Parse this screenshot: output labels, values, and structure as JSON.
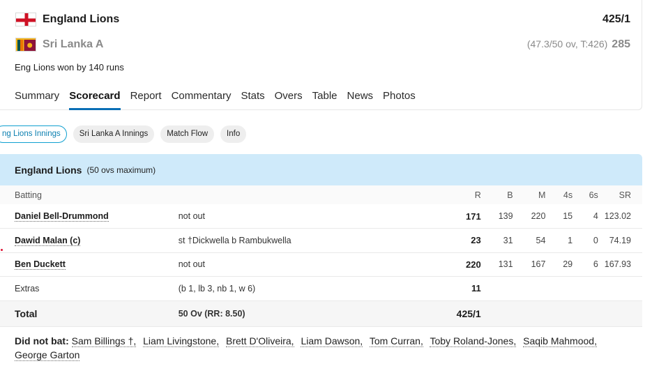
{
  "teams": [
    {
      "name": "England Lions",
      "score": "425/1",
      "overs_info": "",
      "flag": "england-flag"
    },
    {
      "name": "Sri Lanka A",
      "score": "285",
      "overs_info": "(47.3/50 ov, T:426)",
      "flag": "sri-lanka-flag"
    }
  ],
  "result": "Eng Lions won by 140 runs",
  "tabs": [
    "Summary",
    "Scorecard",
    "Report",
    "Commentary",
    "Stats",
    "Overs",
    "Table",
    "News",
    "Photos"
  ],
  "active_tab": "Scorecard",
  "pills": [
    "ng Lions Innings",
    "Sri Lanka A Innings",
    "Match Flow",
    "Info"
  ],
  "innings": {
    "title": "England Lions",
    "subtitle": "(50 ovs maximum)"
  },
  "table": {
    "headers": {
      "batting": "Batting",
      "r": "R",
      "b": "B",
      "m": "M",
      "fours": "4s",
      "sixes": "6s",
      "sr": "SR"
    },
    "rows": [
      {
        "name": "Daniel Bell-Drummond",
        "dismissal": "not out",
        "r": "171",
        "b": "139",
        "m": "220",
        "fours": "15",
        "sixes": "4",
        "sr": "123.02"
      },
      {
        "name": "Dawid Malan (c)",
        "dismissal": "st †Dickwella b Rambukwella",
        "r": "23",
        "b": "31",
        "m": "54",
        "fours": "1",
        "sixes": "0",
        "sr": "74.19"
      },
      {
        "name": "Ben Duckett",
        "dismissal": "not out",
        "r": "220",
        "b": "131",
        "m": "167",
        "fours": "29",
        "sixes": "6",
        "sr": "167.93"
      }
    ],
    "extras": {
      "label": "Extras",
      "detail": "(b 1, lb 3, nb 1, w 6)",
      "value": "11"
    },
    "total": {
      "label": "Total",
      "detail": "50 Ov (RR: 8.50)",
      "value": "425/1"
    }
  },
  "did_not_bat": {
    "label": "Did not bat:",
    "players": [
      "Sam Billings †,",
      "Liam Livingstone,",
      "Brett D'Oliveira,",
      "Liam Dawson,",
      "Tom Curran,",
      "Toby Roland-Jones,",
      "Saqib Mahmood,",
      "George Garton"
    ]
  },
  "colors": {
    "accent": "#0a6fb5",
    "innings_header_bg": "#cfeafa",
    "pill_active_border": "#10a0d0"
  }
}
